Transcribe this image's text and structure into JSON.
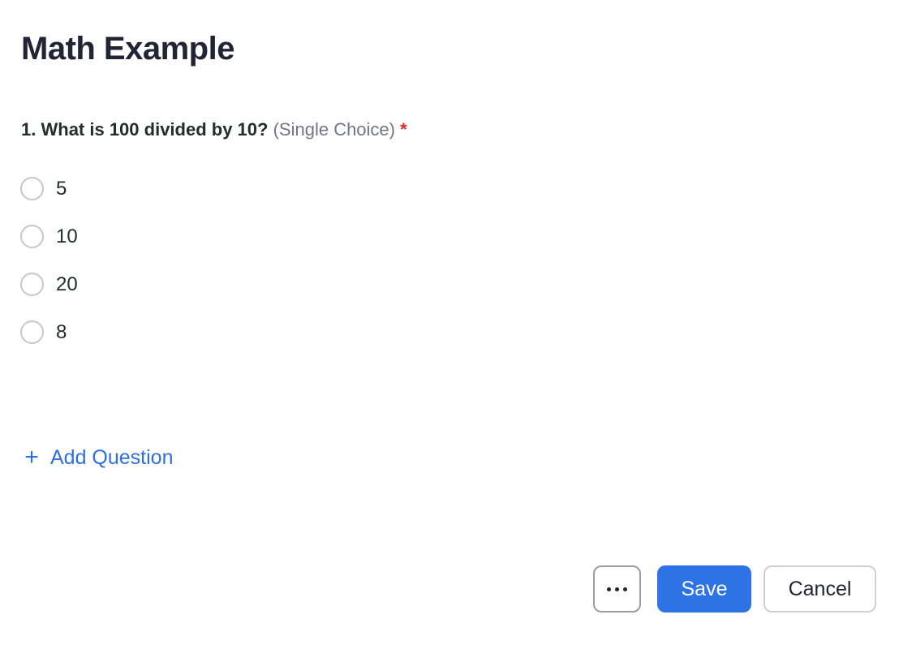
{
  "poll": {
    "title": "Math Example",
    "question": {
      "number": "1.",
      "text": "What is 100 divided by 10?",
      "type": "(Single Choice)",
      "required_marker": "*",
      "options": [
        {
          "label": "5",
          "selected": false
        },
        {
          "label": "10",
          "selected": false
        },
        {
          "label": "20",
          "selected": false
        },
        {
          "label": "8",
          "selected": false
        }
      ]
    },
    "add_question": {
      "icon": "plus-icon",
      "label": "Add Question"
    }
  },
  "footer": {
    "more_icon": "ellipsis-icon",
    "save_label": "Save",
    "cancel_label": "Cancel"
  },
  "colors": {
    "accent": "#2d73e6",
    "link": "#2d6fe0",
    "required": "#e02828",
    "title": "#232333",
    "muted": "#747487"
  }
}
